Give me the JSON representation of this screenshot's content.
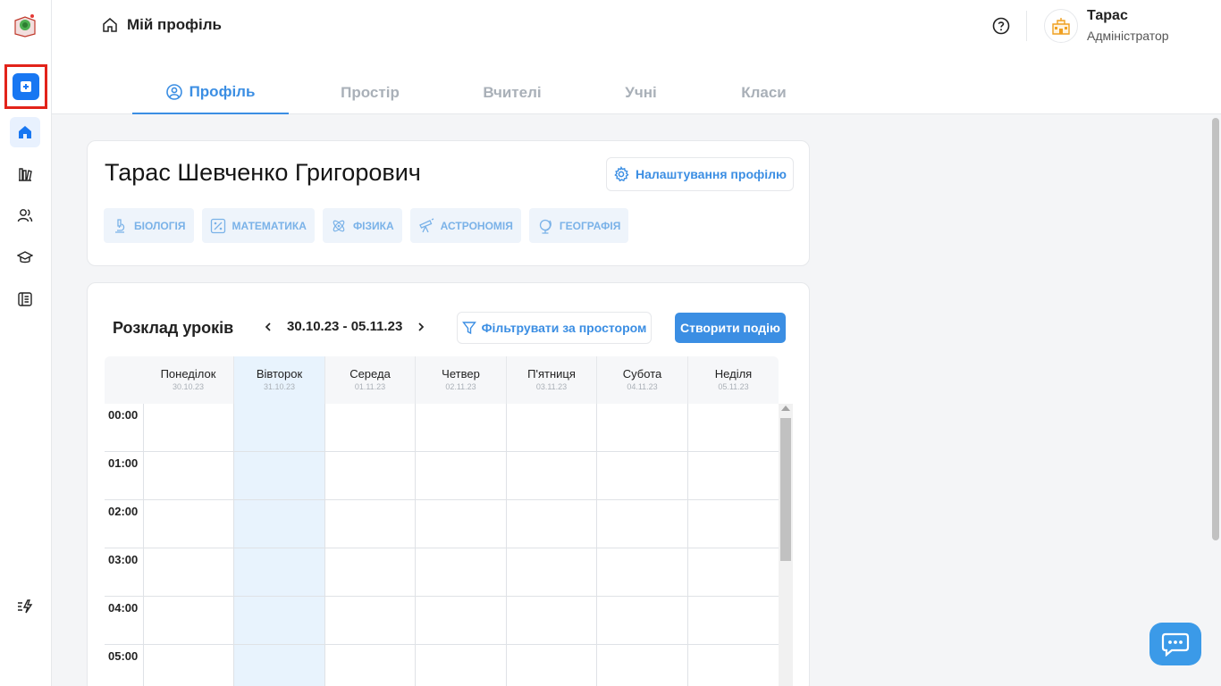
{
  "header": {
    "breadcrumb": "Мій профіль",
    "user_name": "Тарас",
    "user_role": "Адміністратор"
  },
  "tabs": [
    {
      "label": "Профіль",
      "active": true
    },
    {
      "label": "Простір",
      "active": false
    },
    {
      "label": "Вчителі",
      "active": false
    },
    {
      "label": "Учні",
      "active": false
    },
    {
      "label": "Класи",
      "active": false
    }
  ],
  "profile": {
    "full_name": "Тарас Шевченко Григорович",
    "settings_label": "Налаштування профілю",
    "subjects": [
      {
        "label": "БІОЛОГІЯ",
        "icon": "microscope-icon"
      },
      {
        "label": "МАТЕМАТИКА",
        "icon": "percent-icon"
      },
      {
        "label": "ФІЗИКА",
        "icon": "atom-icon"
      },
      {
        "label": "АСТРОНОМІЯ",
        "icon": "telescope-icon"
      },
      {
        "label": "ГЕОГРАФІЯ",
        "icon": "globe-icon"
      }
    ]
  },
  "schedule": {
    "title": "Розклад уроків",
    "week_range": "30.10.23 - 05.11.23",
    "filter_label": "Фільтрувати за простором",
    "create_label": "Створити подію",
    "days": [
      {
        "name": "Понеділок",
        "date": "30.10.23",
        "active": false
      },
      {
        "name": "Вівторок",
        "date": "31.10.23",
        "active": true
      },
      {
        "name": "Середа",
        "date": "01.11.23",
        "active": false
      },
      {
        "name": "Четвер",
        "date": "02.11.23",
        "active": false
      },
      {
        "name": "П'ятниця",
        "date": "03.11.23",
        "active": false
      },
      {
        "name": "Субота",
        "date": "04.11.23",
        "active": false
      },
      {
        "name": "Неділя",
        "date": "05.11.23",
        "active": false
      }
    ],
    "hours": [
      "00:00",
      "01:00",
      "02:00",
      "03:00",
      "04:00",
      "05:00"
    ]
  },
  "colors": {
    "accent": "#3b8ee3",
    "primary_button": "#1877f2",
    "highlight": "#e2231a",
    "active_column": "#e8f3fd"
  },
  "sidebar": {
    "icons": [
      "home-icon",
      "library-icon",
      "users-icon",
      "graduation-cap-icon",
      "journal-icon",
      "quick-actions-icon"
    ]
  }
}
